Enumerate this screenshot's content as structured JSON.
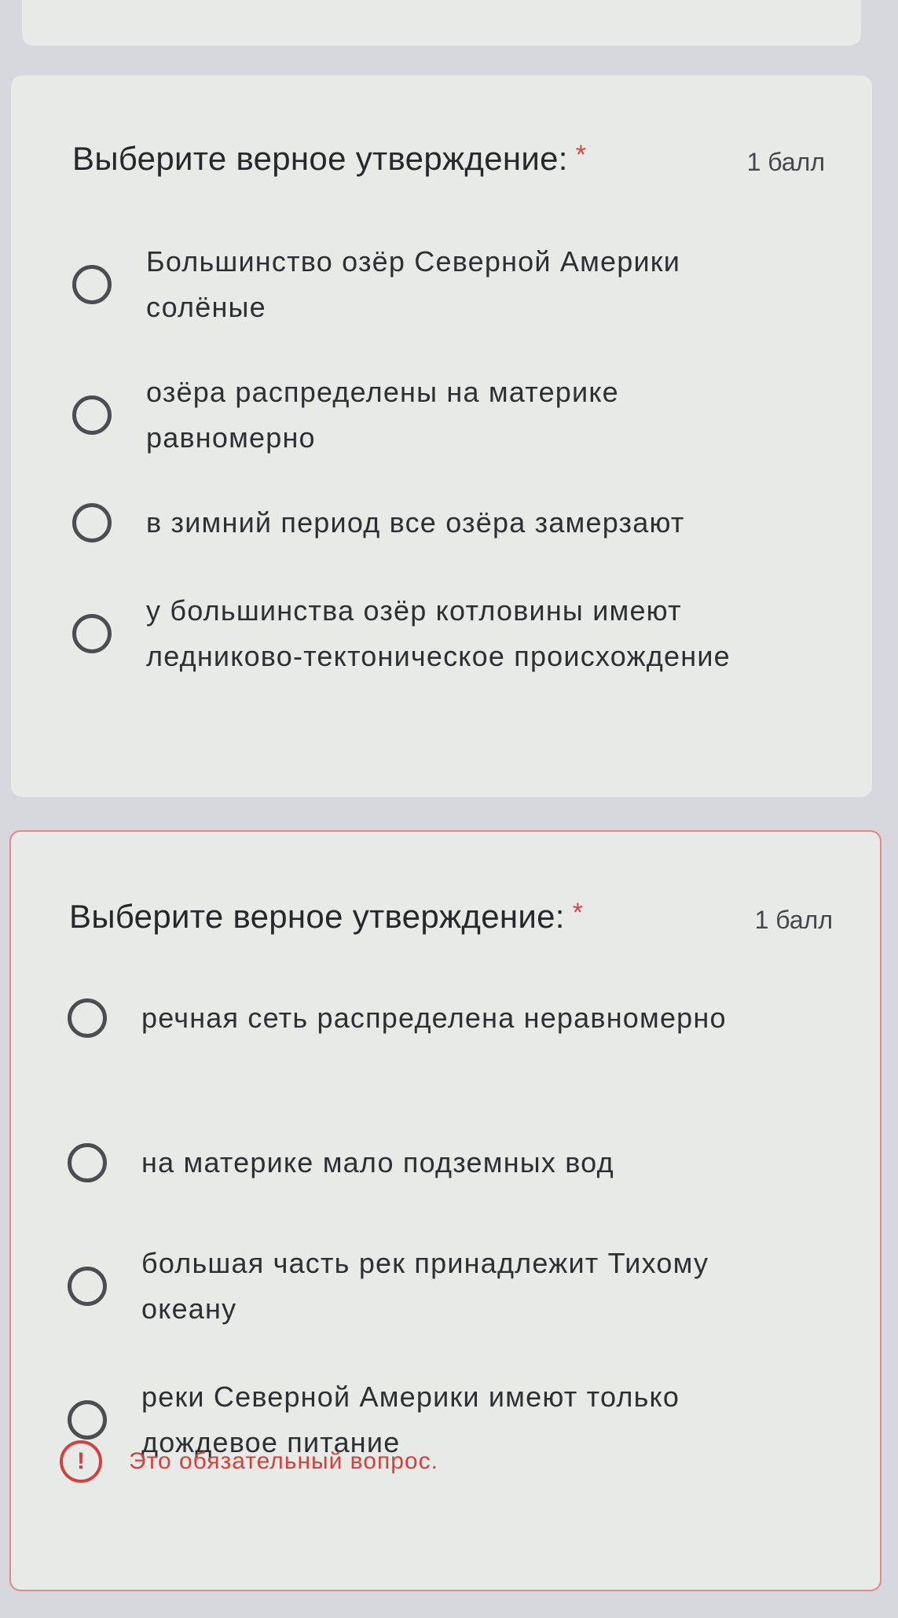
{
  "questions": [
    {
      "title": "Выберите верное утверждение:",
      "required_mark": "*",
      "points": "1 балл",
      "options": [
        "Большинство озёр Северной Америки солёные",
        "озёра распределены на материке равномерно",
        "в зимний период все озёра замерзают",
        "у большинства озёр котловины имеют ледниково-тектоническое происхождение"
      ]
    },
    {
      "title": "Выберите верное утверждение:",
      "required_mark": "*",
      "points": "1 балл",
      "options": [
        "речная сеть распределена неравномерно",
        "на материке мало подземных вод",
        "большая часть рек принадлежит Тихому океану",
        "реки Северной Америки имеют только дождевое питание"
      ],
      "error": {
        "icon": "alert-icon",
        "icon_glyph": "!",
        "text": "Это обязательный вопрос."
      }
    }
  ],
  "colors": {
    "error": "#d2423c",
    "card": "#e8eae8",
    "background": "#d7d8dd"
  }
}
